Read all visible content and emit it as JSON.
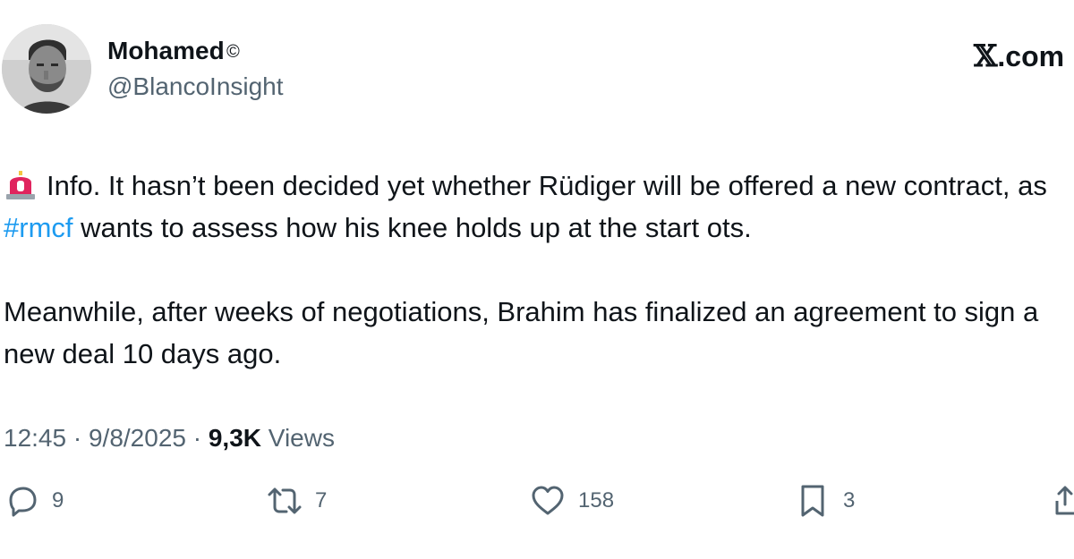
{
  "author": {
    "display_name": "Mohamed",
    "name_badge": "©",
    "handle": "@BlancoInsight"
  },
  "brand": {
    "x_glyph": "𝕏",
    "suffix": ".com"
  },
  "tweet": {
    "emoji": "siren-icon",
    "paragraph1_before": "Info. It hasn’t been decided yet whether Rüdiger will be offered a new contract, as ",
    "hashtag": "#rmcf",
    "paragraph1_after": " wants to assess how his knee holds up at the start ots.",
    "paragraph2": "Meanwhile, after weeks of negotiations, Brahim has finalized an agreement to sign a new deal 10 days ago."
  },
  "meta": {
    "time": "12:45",
    "separator": " · ",
    "date": "9/8/2025",
    "views_count": "9,3K",
    "views_label": " Views"
  },
  "actions": {
    "reply_count": "9",
    "repost_count": "7",
    "like_count": "158",
    "bookmark_count": "3"
  },
  "colors": {
    "text": "#0f1419",
    "secondary": "#536471",
    "link": "#1d9bf0",
    "background": "#ffffff"
  }
}
